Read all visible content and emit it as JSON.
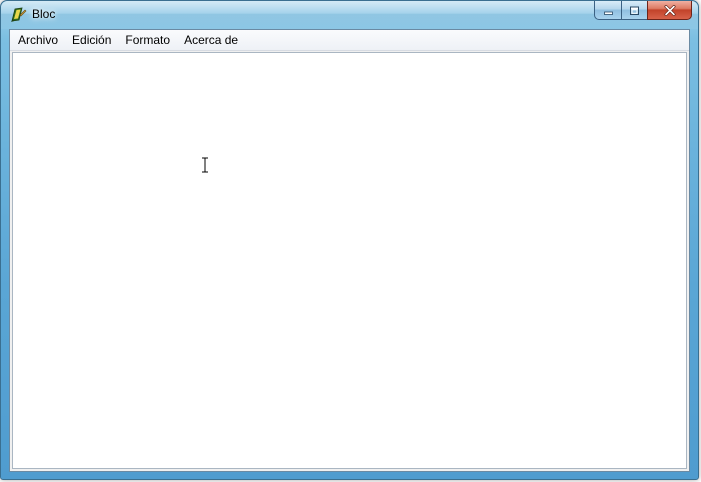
{
  "window": {
    "title": "Bloc",
    "app_icon": "notepad-app-icon",
    "controls": {
      "minimize_icon": "minimize-icon",
      "maximize_icon": "maximize-icon",
      "close_icon": "close-icon"
    }
  },
  "menubar": {
    "items": [
      {
        "label": "Archivo"
      },
      {
        "label": "Edición"
      },
      {
        "label": "Formato"
      },
      {
        "label": "Acerca de"
      }
    ]
  },
  "editor": {
    "value": "",
    "cursor_icon": "text-cursor-icon"
  },
  "colors": {
    "frame": "#6bb3dc",
    "close_button": "#c2432a",
    "menubar": "#eef1f6"
  }
}
